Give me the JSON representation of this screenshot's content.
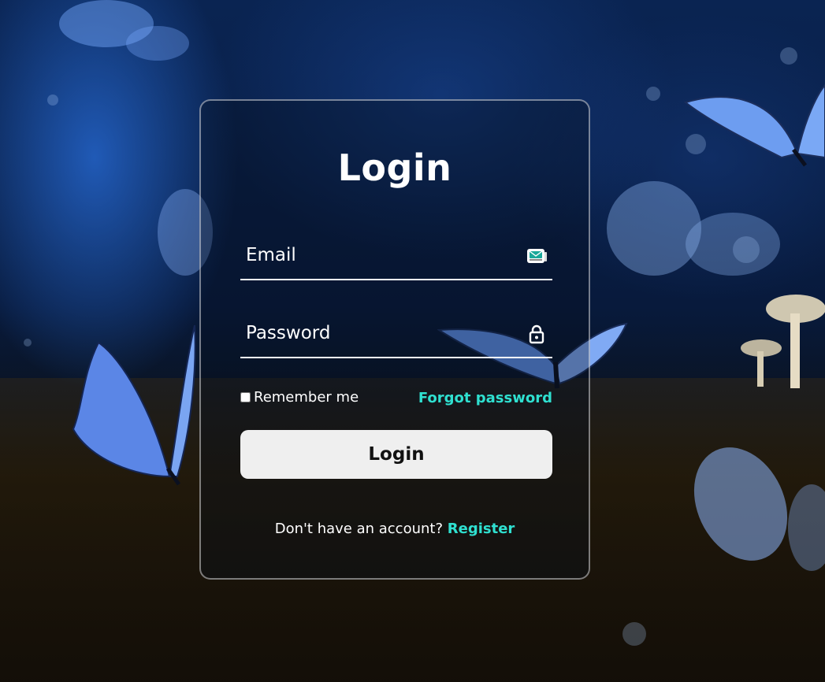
{
  "login_form": {
    "title": "Login",
    "email_placeholder": "Email",
    "password_placeholder": "Password",
    "remember_label": "Remember me",
    "forgot_label": "Forgot password",
    "submit_label": "Login",
    "register_prompt": "Don't have an account?",
    "register_link": "Register"
  },
  "icons": {
    "email": "mail-icon",
    "password": "lock-icon"
  },
  "colors": {
    "accent": "#2fe0d0",
    "button_bg": "#efefef",
    "card_border": "rgba(255,255,255,0.45)"
  }
}
